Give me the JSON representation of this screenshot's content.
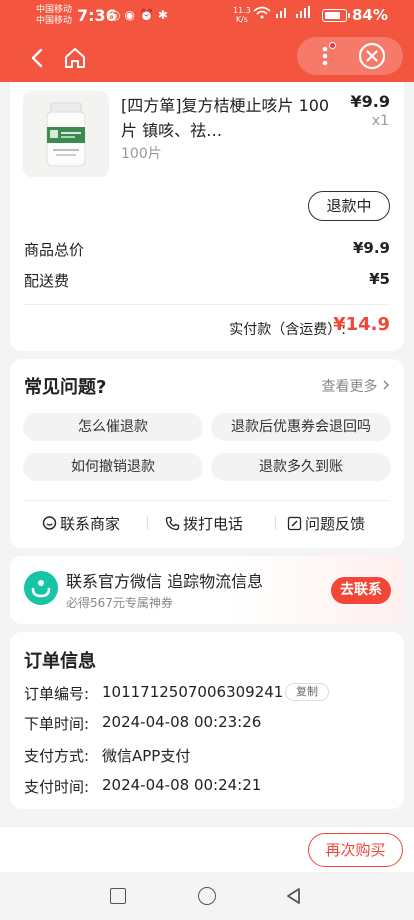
{
  "status_bar": {
    "carrier_1": "中国移动",
    "carrier_2": "中国移动",
    "time": "7:36",
    "net_speed_value": "11.3",
    "net_speed_unit": "K/s",
    "battery_percent": "84%",
    "battery_level": 0.84
  },
  "product": {
    "name": "[四方箪]复方桔梗止咳片 100片 镇咳、祛…",
    "spec": "100片",
    "price": "¥9.9",
    "quantity": "x1",
    "status_button": "退款中"
  },
  "summary": {
    "goods_total_label": "商品总价",
    "goods_total_value": "¥9.9",
    "shipping_label": "配送费",
    "shipping_value": "¥5",
    "paid_label": "实付款（含运费）:",
    "paid_value": "¥14.9"
  },
  "faq": {
    "title": "常见问题?",
    "more": "查看更多",
    "questions": [
      "怎么催退款",
      "退款后优惠券会退回吗",
      "如何撤销退款",
      "退款多久到账"
    ],
    "actions": [
      "联系商家",
      "拨打电话",
      "问题反馈"
    ]
  },
  "wechat_banner": {
    "title": "联系官方微信 追踪物流信息",
    "subtitle": "必得567元专属神券",
    "button": "去联系"
  },
  "order_info": {
    "title": "订单信息",
    "rows": [
      {
        "label": "订单编号:",
        "value": "1011712507006309241"
      },
      {
        "label": "下单时间:",
        "value": "2024-04-08 00:23:26"
      },
      {
        "label": "支付方式:",
        "value": "微信APP支付"
      },
      {
        "label": "支付时间:",
        "value": "2024-04-08 00:24:21"
      }
    ],
    "copy_button": "复制"
  },
  "bottom_bar": {
    "rebuy_button": "再次购买"
  },
  "colors": {
    "brand": "#f3553f",
    "accent_red": "#f04637",
    "wechat_teal": "#17c4a5"
  },
  "icons": [
    "back-icon",
    "home-icon",
    "more-icon",
    "close-icon",
    "chat-icon",
    "phone-icon",
    "feedback-icon",
    "chevron-right-icon"
  ]
}
